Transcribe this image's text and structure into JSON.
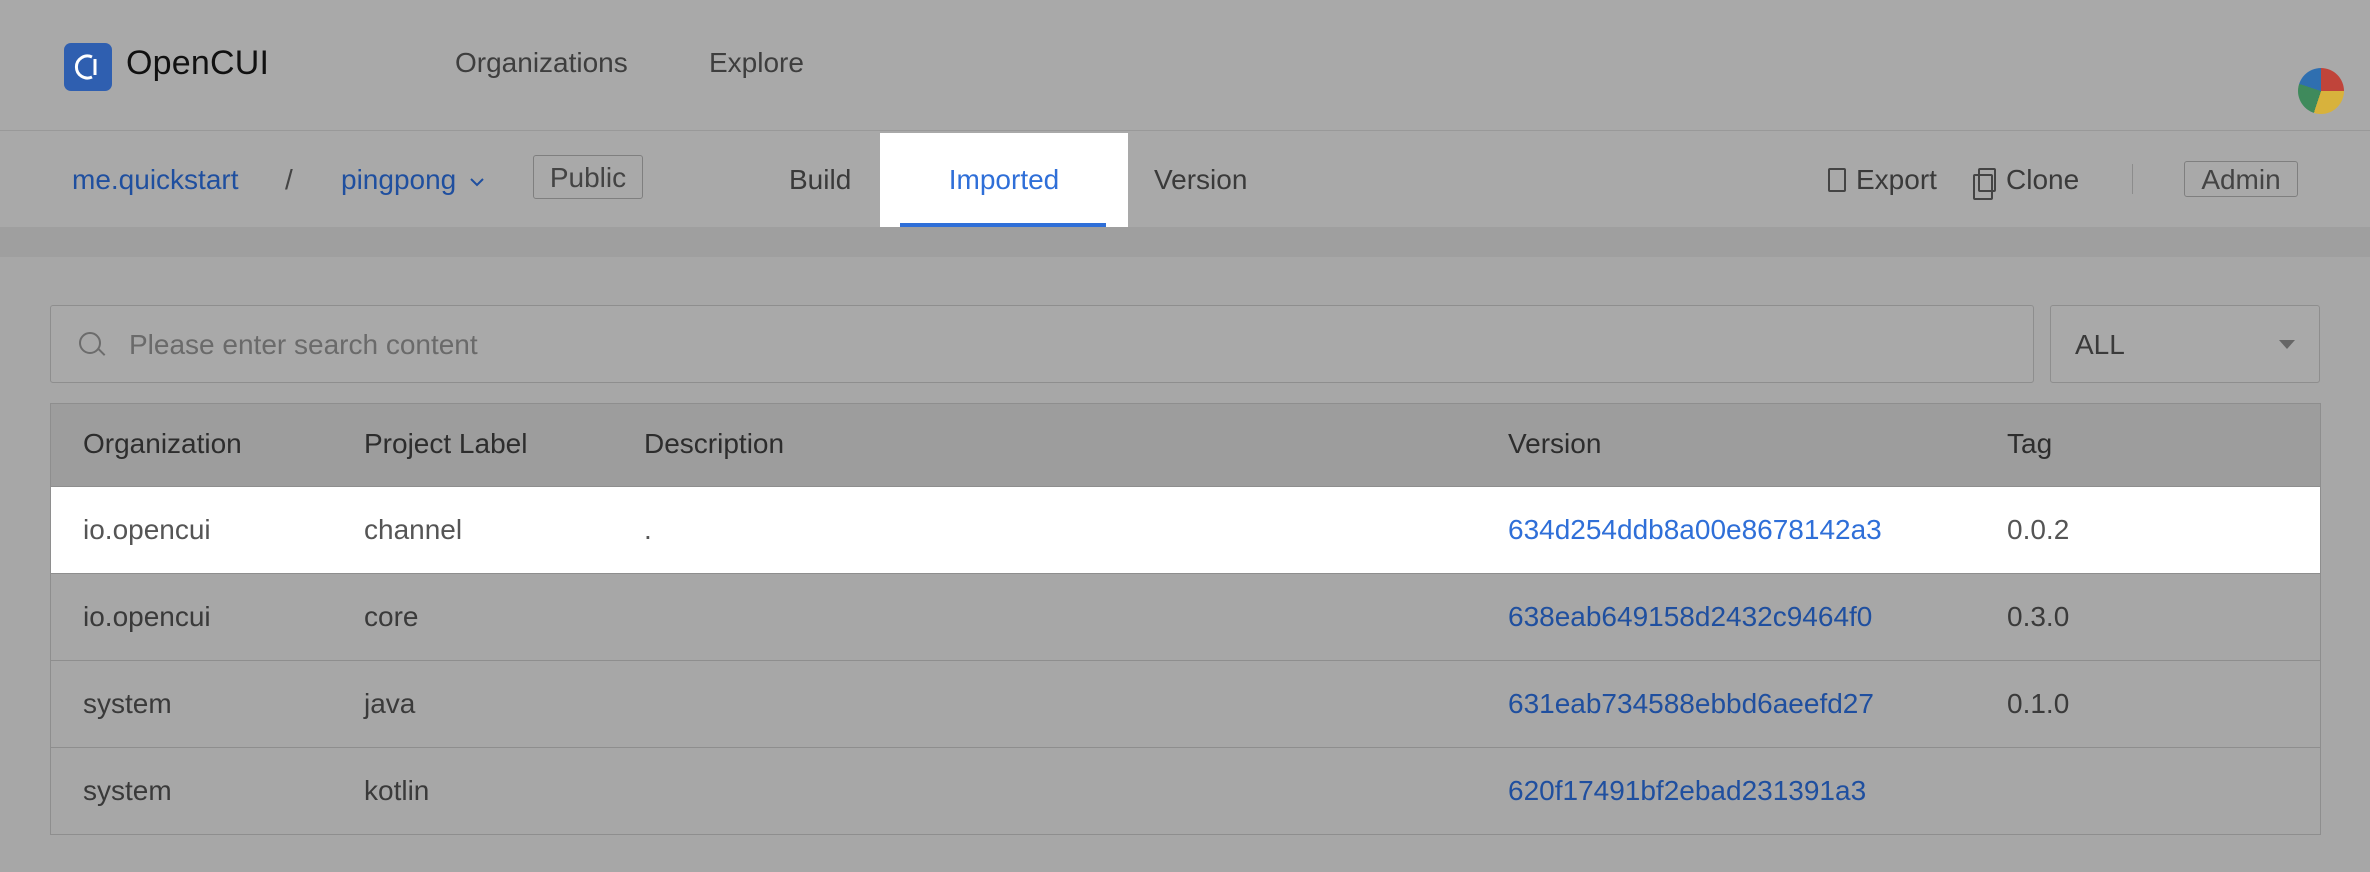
{
  "app": {
    "name": "OpenCUI"
  },
  "topnav": {
    "items": [
      "Organizations",
      "Explore"
    ]
  },
  "breadcrumb": {
    "org": "me.quickstart",
    "separator": "/",
    "project": "pingpong",
    "visibility": "Public"
  },
  "tabs": {
    "build": "Build",
    "imported": "Imported",
    "version": "Version",
    "active": "Imported"
  },
  "actions": {
    "export": "Export",
    "clone": "Clone",
    "admin": "Admin"
  },
  "search": {
    "placeholder": "Please enter search content",
    "value": ""
  },
  "filter": {
    "selected": "ALL"
  },
  "table": {
    "columns": [
      "Organization",
      "Project Label",
      "Description",
      "Version",
      "Tag"
    ],
    "rows": [
      {
        "org": "io.opencui",
        "label": "channel",
        "desc": ".",
        "version": "634d254ddb8a00e8678142a3",
        "tag": "0.0.2"
      },
      {
        "org": "io.opencui",
        "label": "core",
        "desc": "",
        "version": "638eab649158d2432c9464f0",
        "tag": "0.3.0"
      },
      {
        "org": "system",
        "label": "java",
        "desc": "",
        "version": "631eab734588ebbd6aeefd27",
        "tag": "0.1.0"
      },
      {
        "org": "system",
        "label": "kotlin",
        "desc": "",
        "version": "620f17491bf2ebad231391a3",
        "tag": ""
      }
    ]
  },
  "colors": {
    "accent": "#2f6fd8",
    "link": "#1f4f9f",
    "brand": "#2f5fb0"
  }
}
